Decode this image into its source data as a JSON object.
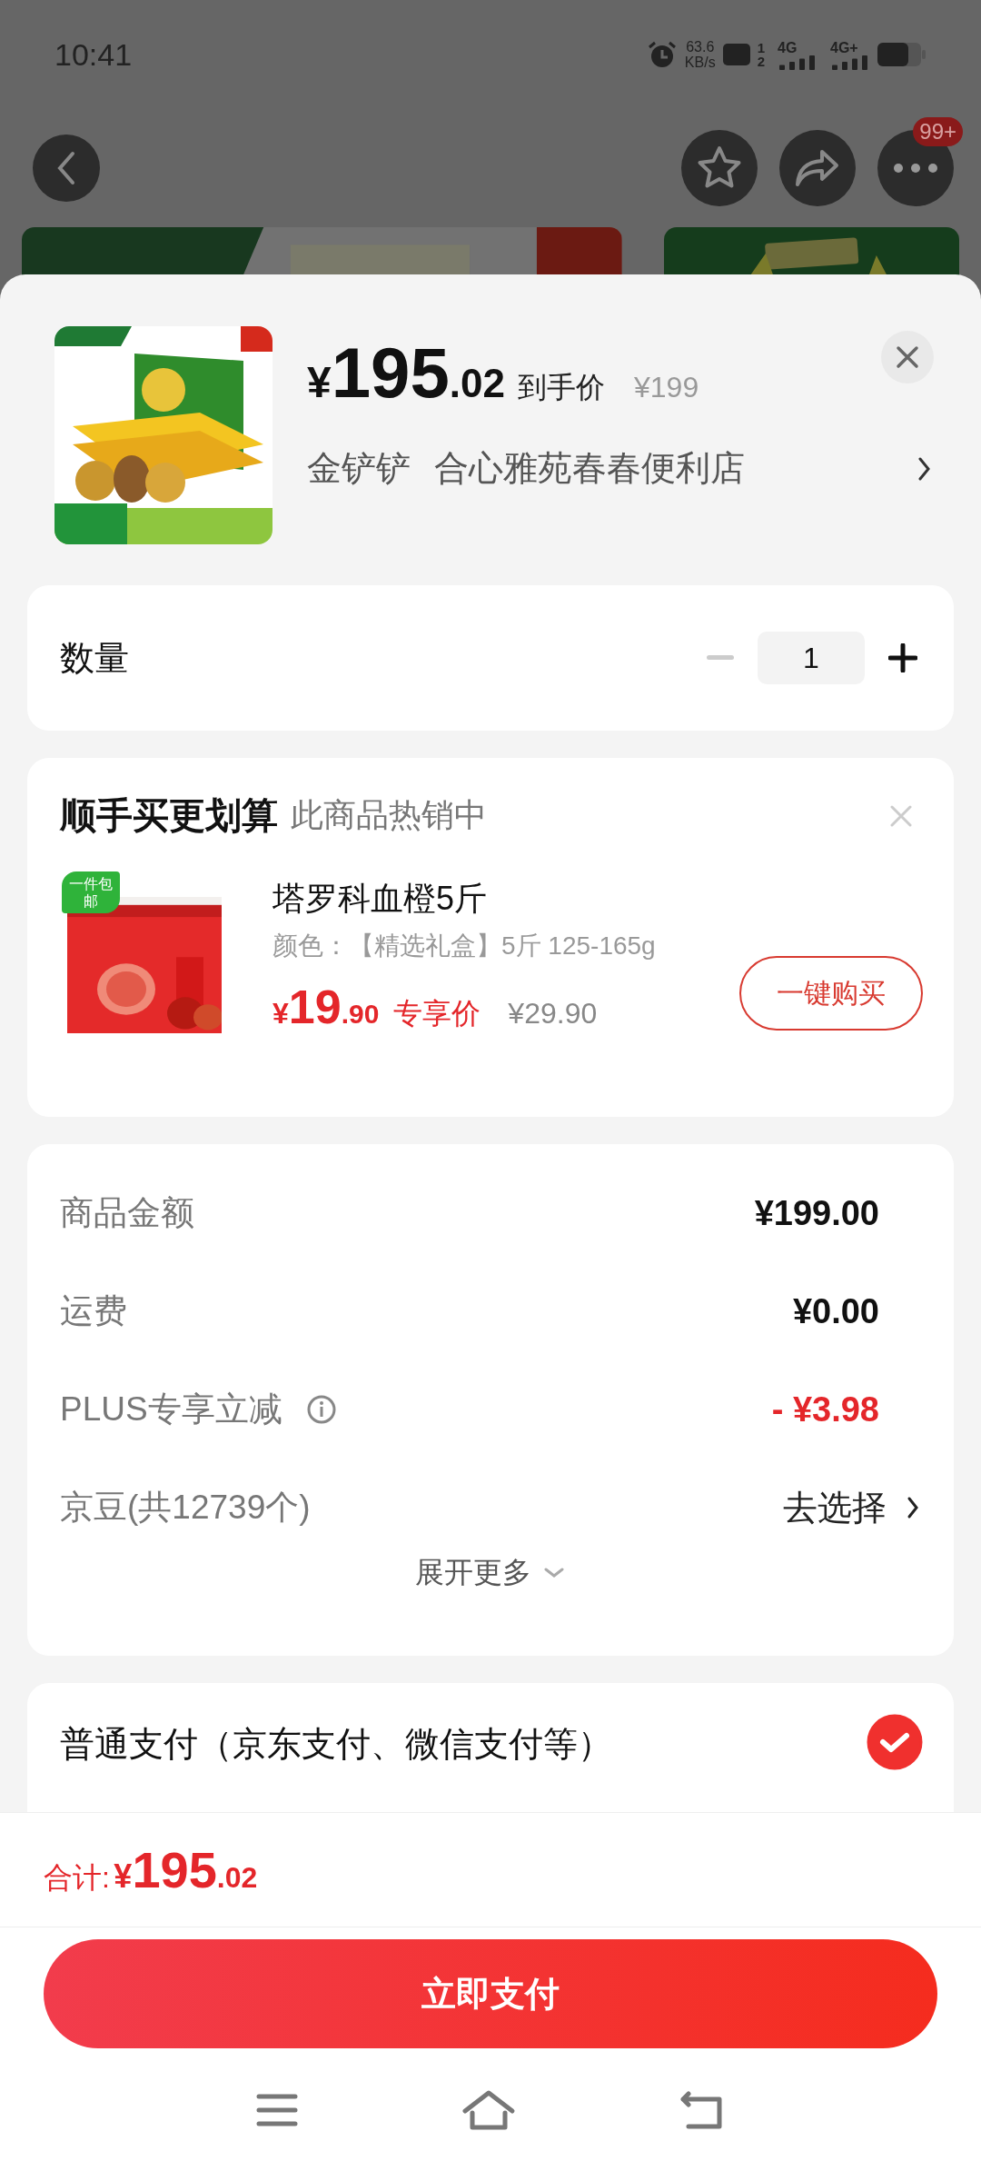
{
  "status_bar": {
    "time": "10:41",
    "net_speed": "63.6",
    "net_unit": "KB/s",
    "hd_sims": [
      "1",
      "2"
    ],
    "networks": [
      "4G",
      "4G+"
    ]
  },
  "nav": {
    "badge": "99+"
  },
  "product": {
    "currency": "¥",
    "price_yuan": "195",
    "price_cents": ".02",
    "price_label": "到手价",
    "original_price": "¥199",
    "store_brand": "金铲铲",
    "store_name": "合心雅苑春春便利店"
  },
  "quantity": {
    "label": "数量",
    "value": "1"
  },
  "addon": {
    "title": "顺手买更划算",
    "subtitle": "此商品热销中",
    "item": {
      "badge": "一件包邮",
      "name": "塔罗科血橙5斤",
      "spec": "颜色：【精选礼盒】5斤 125-165g",
      "currency": "¥",
      "price_yuan": "19",
      "price_cents": ".90",
      "price_label": "专享价",
      "original_price": "¥29.90",
      "button": "一键购买"
    }
  },
  "costs": {
    "rows": [
      {
        "kind": "plain",
        "label": "商品金额",
        "value": "¥199.00",
        "info": false
      },
      {
        "kind": "plain",
        "label": "运费",
        "value": "¥0.00",
        "info": false
      },
      {
        "kind": "discount",
        "label": "PLUS专享立减",
        "value": "- ¥3.98",
        "info": true
      },
      {
        "kind": "link",
        "label": "京豆(共12739个)",
        "value": "去选择",
        "info": false
      }
    ],
    "expand": "展开更多"
  },
  "payment": {
    "label": "普通支付（京东支付、微信支付等）",
    "selected": true
  },
  "total": {
    "label": "合计:",
    "currency": "¥",
    "yuan": "195",
    "cents": ".02"
  },
  "pay_button": "立即支付"
}
